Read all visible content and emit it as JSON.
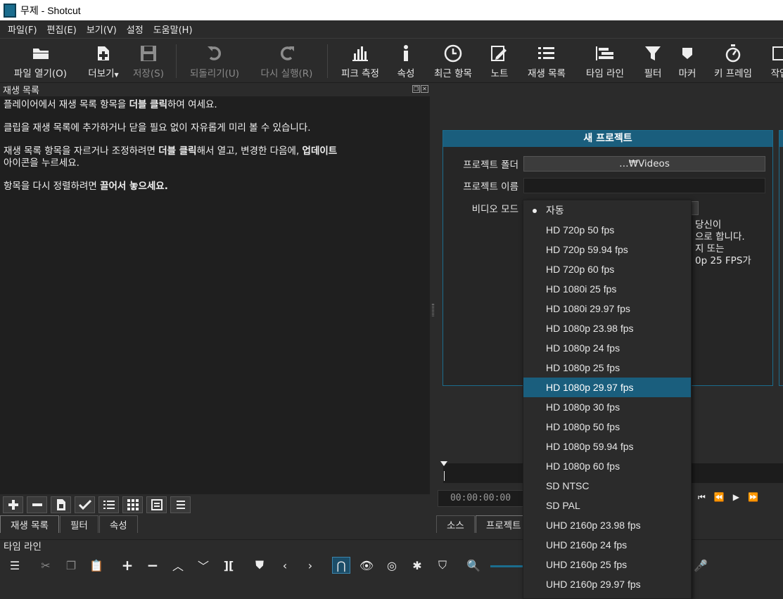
{
  "window": {
    "title": "무제 - Shotcut"
  },
  "menu": [
    "파일(F)",
    "편집(E)",
    "보기(V)",
    "설정",
    "도움말(H)"
  ],
  "toolbar": {
    "open": "파일 열기(O)",
    "more": "더보기",
    "save": "저장(S)",
    "undo": "되돌리기(U)",
    "redo": "다시 실행(R)",
    "peak": "피크 측정",
    "properties": "속성",
    "recent": "최근 항목",
    "notes": "노트",
    "playlist": "재생 목록",
    "timeline": "타임 라인",
    "filters": "필터",
    "markers": "마커",
    "keyframes": "키 프레임",
    "jobs": "작업"
  },
  "playlist_panel": {
    "title": "재생 목록",
    "line1_a": "플레이어에서 재생 목록 항목을 ",
    "line1_b": "더블 클릭",
    "line1_c": "하여 여세요.",
    "line2": "클립을 재생 목록에 추가하거나 닫을 필요 없이 자유롭게 미리 볼 수 있습니다.",
    "line3_a": "재생 목록 항목을 자르거나 조정하려면 ",
    "line3_b": "더블 클릭",
    "line3_c": "해서 열고, 변경한 다음에, ",
    "line3_d": "업데이트",
    "line3_e": "아이콘을 누르세요.",
    "line4_a": "항목을 다시 정렬하려면 ",
    "line4_b": "끌어서 놓으세요."
  },
  "left_tabs": [
    "재생 목록",
    "필터",
    "속성"
  ],
  "new_project": {
    "title": "새 프로젝트",
    "folder_label": "프로젝트 폴더",
    "folder_value": "…₩Videos",
    "name_label": "프로젝트 이름",
    "name_value": "",
    "mode_label": "비디오 모드",
    "desc_lines": [
      "당신이",
      "으로 합니다.",
      "지 또는",
      "0p 25 FPS가"
    ]
  },
  "player": {
    "timecode": "00:00:00:00"
  },
  "right_tabs": [
    "소스",
    "프로젝트"
  ],
  "timeline_title": "타임 라인",
  "video_modes": {
    "selected_index": 8,
    "items": [
      "자동",
      "HD 720p 50 fps",
      "HD 720p 59.94 fps",
      "HD 720p 60 fps",
      "HD 1080i 25 fps",
      "HD 1080i 29.97 fps",
      "HD 1080p 23.98 fps",
      "HD 1080p 24 fps",
      "HD 1080p 25 fps",
      "HD 1080p 29.97 fps",
      "HD 1080p 30 fps",
      "HD 1080p 50 fps",
      "HD 1080p 59.94 fps",
      "HD 1080p 60 fps",
      "SD NTSC",
      "SD PAL",
      "UHD 2160p 23.98 fps",
      "UHD 2160p 24 fps",
      "UHD 2160p 25 fps",
      "UHD 2160p 29.97 fps"
    ]
  },
  "colors": {
    "accent": "#1a5e7d",
    "selection": "#1a5e7d"
  }
}
